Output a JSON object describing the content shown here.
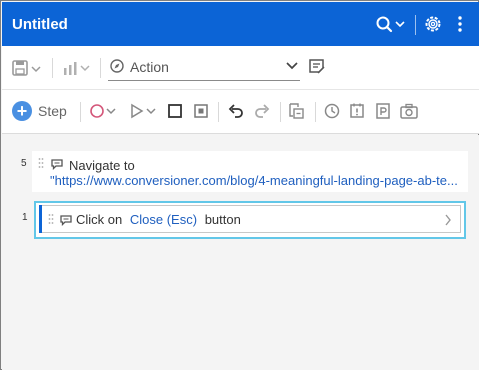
{
  "window": {
    "title": "Untitled"
  },
  "toolbar": {
    "action_select_value": "Action"
  },
  "toolbar2": {
    "step_label": "Step"
  },
  "steps": [
    {
      "number": "5",
      "label": "Navigate to",
      "url": "\"https://www.conversioner.com/blog/4-meaningful-landing-page-ab-te..."
    },
    {
      "number": "1",
      "prefix": "Click on",
      "target": "Close (Esc)",
      "suffix": "button"
    }
  ],
  "colors": {
    "accent": "#0c64d6",
    "link": "#1f5fbf",
    "selection": "#62c7e8"
  }
}
